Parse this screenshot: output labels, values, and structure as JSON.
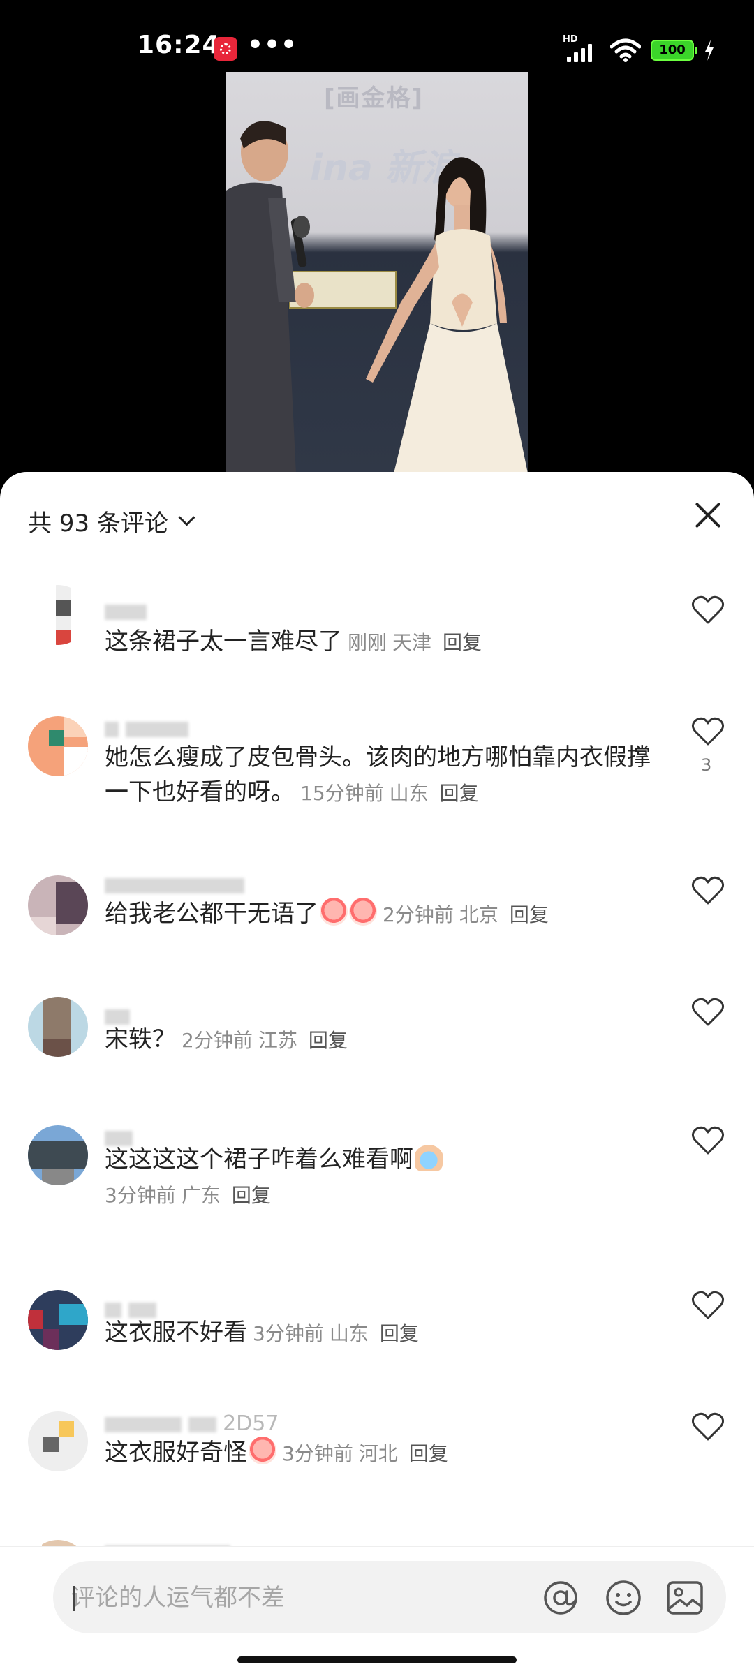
{
  "status_bar": {
    "time": "16:24",
    "more": "•••",
    "network": "HD",
    "battery": "100"
  },
  "video": {
    "screen_text": "[画金格]",
    "logo_text": "ina 新浪"
  },
  "comments_panel": {
    "count_label": "共 93 条评论",
    "comments": [
      {
        "text": "这条裙子太一言难尽了",
        "time": "刚刚",
        "location": "天津",
        "reply": "回复",
        "likes": ""
      },
      {
        "text": "她怎么瘦成了皮包骨头。该肉的地方哪怕靠内衣假撑一下也好看的呀。",
        "time": "15分钟前",
        "location": "山东",
        "reply": "回复",
        "likes": "3"
      },
      {
        "text": "给我老公都干无语了",
        "time": "2分钟前",
        "location": "北京",
        "reply": "回复",
        "likes": ""
      },
      {
        "text": "宋轶？",
        "time": "2分钟前",
        "location": "江苏",
        "reply": "回复",
        "likes": ""
      },
      {
        "text": "这这这这个裙子咋着么难看啊",
        "time": "3分钟前",
        "location": "广东",
        "reply": "回复",
        "likes": ""
      },
      {
        "text": "这衣服不好看",
        "time": "3分钟前",
        "location": "山东",
        "reply": "回复",
        "likes": ""
      },
      {
        "text": "这衣服好奇怪",
        "time": "3分钟前",
        "location": "河北",
        "reply": "回复",
        "likes": "",
        "username_suffix": "2D57"
      }
    ]
  },
  "input": {
    "placeholder": "评论的人运气都不差"
  },
  "icons": {
    "at": "at-icon",
    "emoji": "smiley-icon",
    "image": "image-icon",
    "close": "close-icon",
    "like": "heart-outline-icon"
  }
}
